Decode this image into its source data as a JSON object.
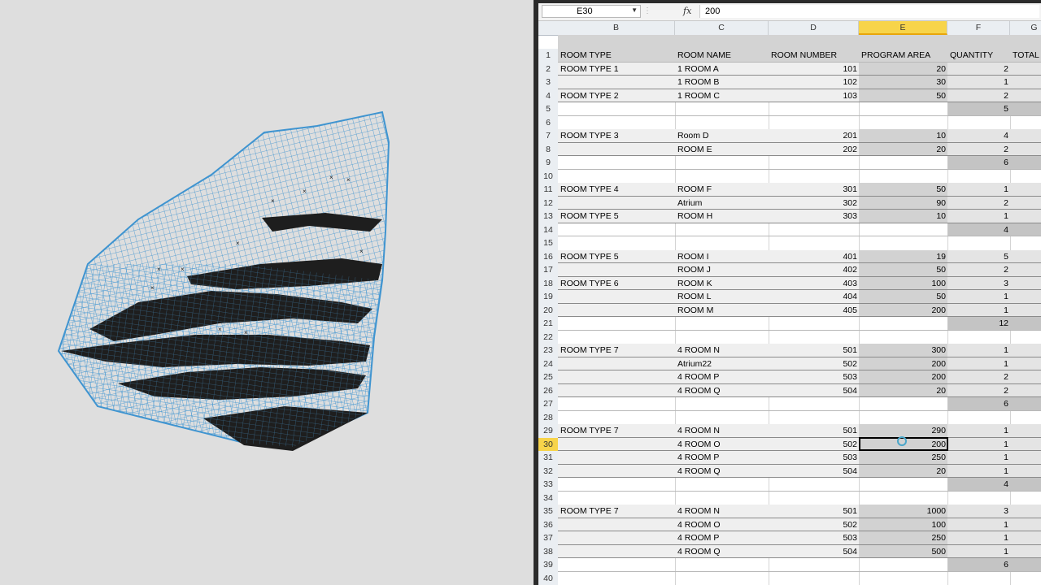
{
  "formula_bar": {
    "name_box": "E30",
    "fx_label": "fx",
    "formula_value": "200"
  },
  "columns": [
    "B",
    "C",
    "D",
    "E",
    "F",
    "G"
  ],
  "headers": {
    "room_type": "ROOM TYPE",
    "room_name": "ROOM NAME",
    "room_number": "ROOM NUMBER",
    "program_area": "PROGRAM AREA",
    "quantity": "QUANTITY",
    "total": "TOTAL"
  },
  "active_cell": "E30",
  "rows": [
    {
      "n": "1",
      "b": "",
      "c": "",
      "d": "",
      "e": "",
      "f": "",
      "kind": "header"
    },
    {
      "n": "2",
      "b": "ROOM TYPE 1",
      "c": "1 ROOM A",
      "d": "101",
      "e": "20",
      "f": "2",
      "kind": "data"
    },
    {
      "n": "3",
      "b": "",
      "c": "1 ROOM B",
      "d": "102",
      "e": "30",
      "f": "1",
      "kind": "data"
    },
    {
      "n": "4",
      "b": "ROOM TYPE 2",
      "c": "1 ROOM C",
      "d": "103",
      "e": "50",
      "f": "2",
      "kind": "data"
    },
    {
      "n": "5",
      "b": "",
      "c": "",
      "d": "",
      "e": "",
      "f": "5",
      "kind": "sum"
    },
    {
      "n": "6",
      "b": "",
      "c": "",
      "d": "",
      "e": "",
      "f": "",
      "kind": "blank"
    },
    {
      "n": "7",
      "b": "ROOM TYPE 3",
      "c": "Room D",
      "d": "201",
      "e": "10",
      "f": "4",
      "kind": "data"
    },
    {
      "n": "8",
      "b": "",
      "c": "ROOM E",
      "d": "202",
      "e": "20",
      "f": "2",
      "kind": "data"
    },
    {
      "n": "9",
      "b": "",
      "c": "",
      "d": "",
      "e": "",
      "f": "6",
      "kind": "sum"
    },
    {
      "n": "10",
      "b": "",
      "c": "",
      "d": "",
      "e": "",
      "f": "",
      "kind": "blank"
    },
    {
      "n": "11",
      "b": "ROOM TYPE 4",
      "c": "ROOM F",
      "d": "301",
      "e": "50",
      "f": "1",
      "kind": "data"
    },
    {
      "n": "12",
      "b": "",
      "c": "Atrium",
      "d": "302",
      "e": "90",
      "f": "2",
      "kind": "data"
    },
    {
      "n": "13",
      "b": "ROOM TYPE 5",
      "c": "ROOM H",
      "d": "303",
      "e": "10",
      "f": "1",
      "kind": "data"
    },
    {
      "n": "14",
      "b": "",
      "c": "",
      "d": "",
      "e": "",
      "f": "4",
      "kind": "sum"
    },
    {
      "n": "15",
      "b": "",
      "c": "",
      "d": "",
      "e": "",
      "f": "",
      "kind": "blank"
    },
    {
      "n": "16",
      "b": "ROOM TYPE 5",
      "c": "ROOM I",
      "d": "401",
      "e": "19",
      "f": "5",
      "kind": "data"
    },
    {
      "n": "17",
      "b": "",
      "c": "ROOM J",
      "d": "402",
      "e": "50",
      "f": "2",
      "kind": "data"
    },
    {
      "n": "18",
      "b": "ROOM TYPE 6",
      "c": "ROOM K",
      "d": "403",
      "e": "100",
      "f": "3",
      "kind": "data"
    },
    {
      "n": "19",
      "b": "",
      "c": "ROOM L",
      "d": "404",
      "e": "50",
      "f": "1",
      "kind": "data"
    },
    {
      "n": "20",
      "b": "",
      "c": "ROOM M",
      "d": "405",
      "e": "200",
      "f": "1",
      "kind": "data"
    },
    {
      "n": "21",
      "b": "",
      "c": "",
      "d": "",
      "e": "",
      "f": "12",
      "kind": "sum"
    },
    {
      "n": "22",
      "b": "",
      "c": "",
      "d": "",
      "e": "",
      "f": "",
      "kind": "blank"
    },
    {
      "n": "23",
      "b": "ROOM TYPE 7",
      "c": "4 ROOM N",
      "d": "501",
      "e": "300",
      "f": "1",
      "kind": "data"
    },
    {
      "n": "24",
      "b": "",
      "c": "Atrium22",
      "d": "502",
      "e": "200",
      "f": "1",
      "kind": "data"
    },
    {
      "n": "25",
      "b": "",
      "c": "4 ROOM P",
      "d": "503",
      "e": "200",
      "f": "2",
      "kind": "data"
    },
    {
      "n": "26",
      "b": "",
      "c": "4 ROOM Q",
      "d": "504",
      "e": "20",
      "f": "2",
      "kind": "data"
    },
    {
      "n": "27",
      "b": "",
      "c": "",
      "d": "",
      "e": "",
      "f": "6",
      "kind": "sum"
    },
    {
      "n": "28",
      "b": "",
      "c": "",
      "d": "",
      "e": "",
      "f": "",
      "kind": "blank"
    },
    {
      "n": "29",
      "b": "ROOM TYPE 7",
      "c": "4 ROOM N",
      "d": "501",
      "e": "290",
      "f": "1",
      "kind": "data"
    },
    {
      "n": "30",
      "b": "",
      "c": "4 ROOM O",
      "d": "502",
      "e": "200",
      "f": "1",
      "kind": "data"
    },
    {
      "n": "31",
      "b": "",
      "c": "4 ROOM P",
      "d": "503",
      "e": "250",
      "f": "1",
      "kind": "data"
    },
    {
      "n": "32",
      "b": "",
      "c": "4 ROOM Q",
      "d": "504",
      "e": "20",
      "f": "1",
      "kind": "data"
    },
    {
      "n": "33",
      "b": "",
      "c": "",
      "d": "",
      "e": "",
      "f": "4",
      "kind": "sum"
    },
    {
      "n": "34",
      "b": "",
      "c": "",
      "d": "",
      "e": "",
      "f": "",
      "kind": "blank"
    },
    {
      "n": "35",
      "b": "ROOM TYPE 7",
      "c": "4 ROOM N",
      "d": "501",
      "e": "1000",
      "f": "3",
      "kind": "data"
    },
    {
      "n": "36",
      "b": "",
      "c": "4 ROOM O",
      "d": "502",
      "e": "100",
      "f": "1",
      "kind": "data"
    },
    {
      "n": "37",
      "b": "",
      "c": "4 ROOM P",
      "d": "503",
      "e": "250",
      "f": "1",
      "kind": "data"
    },
    {
      "n": "38",
      "b": "",
      "c": "4 ROOM Q",
      "d": "504",
      "e": "500",
      "f": "1",
      "kind": "data"
    },
    {
      "n": "39",
      "b": "",
      "c": "",
      "d": "",
      "e": "",
      "f": "6",
      "kind": "sum"
    },
    {
      "n": "40",
      "b": "",
      "c": "",
      "d": "",
      "e": "",
      "f": "",
      "kind": "blank"
    }
  ],
  "viewport": {
    "mesh_color": "#3f94d0",
    "slab_color": "#1e1e1e",
    "background": "#dedede"
  }
}
